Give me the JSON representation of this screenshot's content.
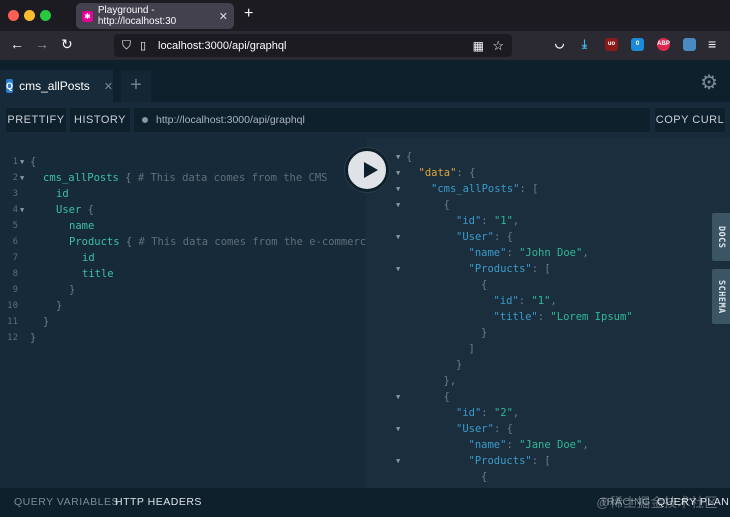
{
  "browser": {
    "tab_title": "Playground - http://localhost:30",
    "url": "localhost:3000/api/graphql",
    "ext_badge": "0"
  },
  "playground": {
    "tab_label": "cms_allPosts",
    "tab_badge": "Q",
    "toolbar": {
      "prettify": "PRETTIFY",
      "history": "HISTORY",
      "endpoint": "http://localhost:3000/api/graphql",
      "copy_curl": "COPY CURL"
    },
    "query_lines": [
      {
        "n": "1",
        "fold": true,
        "indent": 0,
        "parts": [
          [
            "p",
            "{"
          ]
        ]
      },
      {
        "n": "2",
        "fold": true,
        "indent": 1,
        "parts": [
          [
            "f",
            "cms_allPosts"
          ],
          [
            "p",
            " { "
          ],
          [
            "c",
            "# This data comes from the CMS"
          ]
        ]
      },
      {
        "n": "3",
        "fold": false,
        "indent": 2,
        "parts": [
          [
            "f",
            "id"
          ]
        ]
      },
      {
        "n": "4",
        "fold": true,
        "indent": 2,
        "parts": [
          [
            "f",
            "User"
          ],
          [
            "p",
            " {"
          ]
        ]
      },
      {
        "n": "5",
        "fold": false,
        "indent": 3,
        "parts": [
          [
            "f",
            "name"
          ]
        ]
      },
      {
        "n": "6",
        "fold": false,
        "indent": 3,
        "parts": [
          [
            "f",
            "Products"
          ],
          [
            "p",
            " { "
          ],
          [
            "c",
            "# This data comes from the e-commerce"
          ]
        ]
      },
      {
        "n": "7",
        "fold": false,
        "indent": 4,
        "parts": [
          [
            "f",
            "id"
          ]
        ]
      },
      {
        "n": "8",
        "fold": false,
        "indent": 4,
        "parts": [
          [
            "f",
            "title"
          ]
        ]
      },
      {
        "n": "9",
        "fold": false,
        "indent": 3,
        "parts": [
          [
            "p",
            "}"
          ]
        ]
      },
      {
        "n": "10",
        "fold": false,
        "indent": 2,
        "parts": [
          [
            "p",
            "}"
          ]
        ]
      },
      {
        "n": "11",
        "fold": false,
        "indent": 1,
        "parts": [
          [
            "p",
            "}"
          ]
        ]
      },
      {
        "n": "12",
        "fold": false,
        "indent": 0,
        "parts": [
          [
            "p",
            "}"
          ]
        ]
      }
    ],
    "result_lines": [
      {
        "fold": true,
        "indent": 0,
        "parts": [
          [
            "p",
            "{"
          ]
        ]
      },
      {
        "fold": true,
        "indent": 1,
        "parts": [
          [
            "dk",
            "\"data\""
          ],
          [
            "p",
            ": {"
          ]
        ]
      },
      {
        "fold": true,
        "indent": 2,
        "parts": [
          [
            "k",
            "\"cms_allPosts\""
          ],
          [
            "p",
            ": ["
          ]
        ]
      },
      {
        "fold": true,
        "indent": 3,
        "parts": [
          [
            "p",
            "{"
          ]
        ]
      },
      {
        "fold": false,
        "indent": 4,
        "parts": [
          [
            "k",
            "\"id\""
          ],
          [
            "p",
            ": "
          ],
          [
            "s",
            "\"1\""
          ],
          [
            "p",
            ","
          ]
        ]
      },
      {
        "fold": true,
        "indent": 4,
        "parts": [
          [
            "k",
            "\"User\""
          ],
          [
            "p",
            ": {"
          ]
        ]
      },
      {
        "fold": false,
        "indent": 5,
        "parts": [
          [
            "k",
            "\"name\""
          ],
          [
            "p",
            ": "
          ],
          [
            "s",
            "\"John Doe\""
          ],
          [
            "p",
            ","
          ]
        ]
      },
      {
        "fold": true,
        "indent": 5,
        "parts": [
          [
            "k",
            "\"Products\""
          ],
          [
            "p",
            ": ["
          ]
        ]
      },
      {
        "fold": false,
        "indent": 6,
        "parts": [
          [
            "p",
            "{"
          ]
        ]
      },
      {
        "fold": false,
        "indent": 7,
        "parts": [
          [
            "k",
            "\"id\""
          ],
          [
            "p",
            ": "
          ],
          [
            "s",
            "\"1\""
          ],
          [
            "p",
            ","
          ]
        ]
      },
      {
        "fold": false,
        "indent": 7,
        "parts": [
          [
            "k",
            "\"title\""
          ],
          [
            "p",
            ": "
          ],
          [
            "s",
            "\"Lorem Ipsum\""
          ]
        ]
      },
      {
        "fold": false,
        "indent": 6,
        "parts": [
          [
            "p",
            "}"
          ]
        ]
      },
      {
        "fold": false,
        "indent": 5,
        "parts": [
          [
            "p",
            "]"
          ]
        ]
      },
      {
        "fold": false,
        "indent": 4,
        "parts": [
          [
            "p",
            "}"
          ]
        ]
      },
      {
        "fold": false,
        "indent": 3,
        "parts": [
          [
            "p",
            "},"
          ]
        ]
      },
      {
        "fold": true,
        "indent": 3,
        "parts": [
          [
            "p",
            "{"
          ]
        ]
      },
      {
        "fold": false,
        "indent": 4,
        "parts": [
          [
            "k",
            "\"id\""
          ],
          [
            "p",
            ": "
          ],
          [
            "s",
            "\"2\""
          ],
          [
            "p",
            ","
          ]
        ]
      },
      {
        "fold": true,
        "indent": 4,
        "parts": [
          [
            "k",
            "\"User\""
          ],
          [
            "p",
            ": {"
          ]
        ]
      },
      {
        "fold": false,
        "indent": 5,
        "parts": [
          [
            "k",
            "\"name\""
          ],
          [
            "p",
            ": "
          ],
          [
            "s",
            "\"Jane Doe\""
          ],
          [
            "p",
            ","
          ]
        ]
      },
      {
        "fold": true,
        "indent": 5,
        "parts": [
          [
            "k",
            "\"Products\""
          ],
          [
            "p",
            ": ["
          ]
        ]
      },
      {
        "fold": false,
        "indent": 6,
        "parts": [
          [
            "p",
            "{"
          ]
        ]
      }
    ],
    "side_tabs": {
      "docs": "DOCS",
      "schema": "SCHEMA"
    },
    "bottom": {
      "query_variables": "QUERY VARIABLES",
      "http_headers": "HTTP HEADERS",
      "tracing": "TRACING",
      "query_plan": "QUERY PLAN"
    },
    "watermark": "@稀土掘金技术社区"
  }
}
